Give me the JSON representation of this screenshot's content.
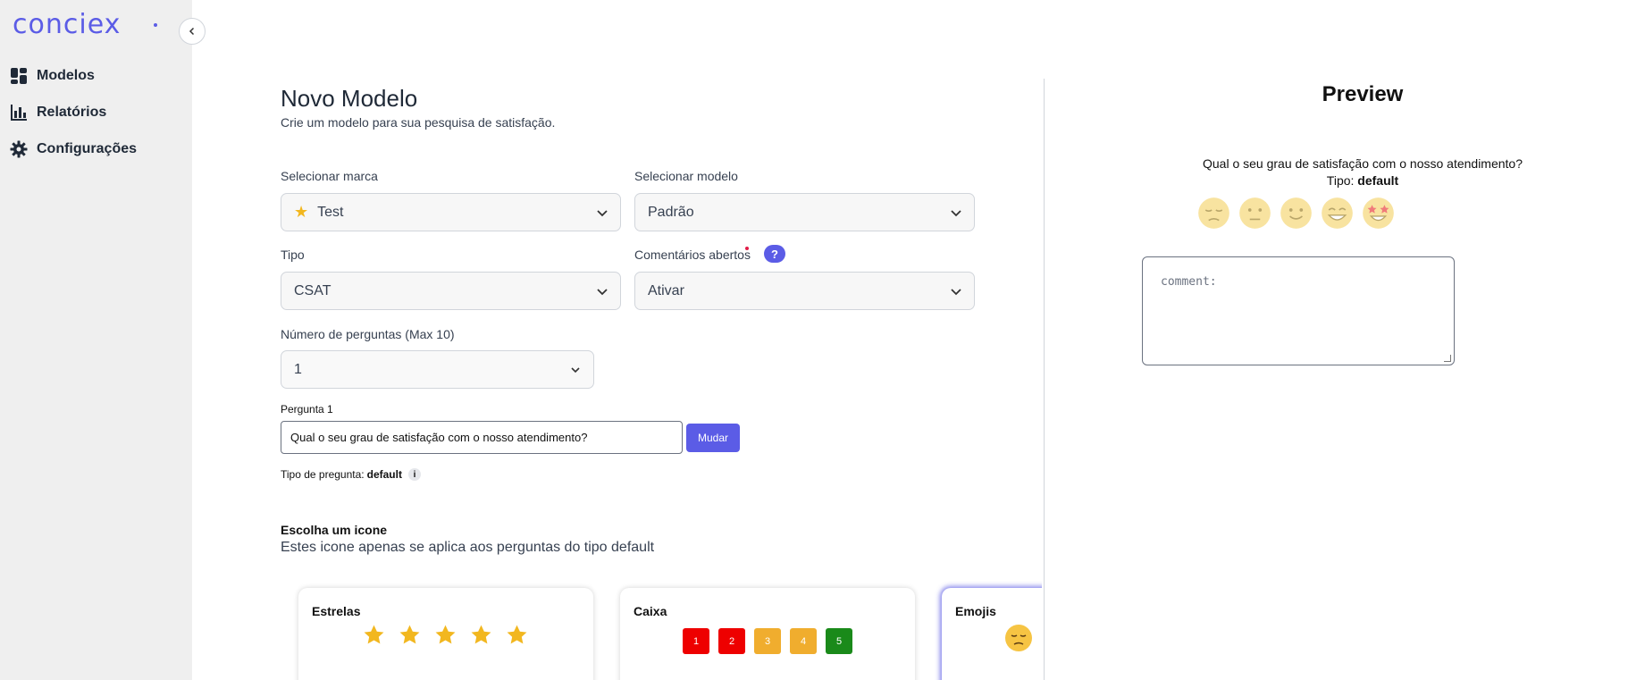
{
  "sidebar": {
    "logo": "conciex",
    "collapse_icon": "chevron-left-icon",
    "items": [
      {
        "label": "Modelos",
        "icon": "dashboard-icon"
      },
      {
        "label": "Relatórios",
        "icon": "bar-chart-icon"
      },
      {
        "label": "Configurações",
        "icon": "gear-icon"
      }
    ]
  },
  "header": {
    "title": "Novo Modelo",
    "subtitle": "Crie um modelo para sua pesquisa de satisfação."
  },
  "form": {
    "brand": {
      "label": "Selecionar marca",
      "value": "Test"
    },
    "model": {
      "label": "Selecionar modelo",
      "value": "Padrão"
    },
    "type": {
      "label": "Tipo",
      "value": "CSAT",
      "help": "?"
    },
    "comments": {
      "label": "Comentários abertos",
      "value": "Ativar"
    },
    "num_questions": {
      "label": "Número de perguntas (Max 10)",
      "value": "1"
    },
    "question": {
      "label": "Pergunta 1",
      "value": "Qual o seu grau de satisfação com o nosso atendimento?",
      "button": "Mudar",
      "type_label": "Tipo de pregunta:",
      "type_value": "default",
      "info": "i"
    }
  },
  "icon_picker": {
    "title": "Escolha um icone",
    "subtitle": "Estes icone apenas se aplica aos perguntas do tipo default",
    "cards": [
      {
        "title": "Estrelas"
      },
      {
        "title": "Caixa",
        "boxes": [
          "1",
          "2",
          "3",
          "4",
          "5"
        ],
        "box_colors": [
          "#ee0000",
          "#ee0000",
          "#f0ad2e",
          "#f0ad2e",
          "#1a8a1a"
        ]
      },
      {
        "title": "Emojis"
      }
    ]
  },
  "preview": {
    "title": "Preview",
    "question": "Qual o seu grau de satisfação com o nosso atendimento?",
    "type_label": "Tipo:",
    "type_value": "default",
    "comment_placeholder": "comment:"
  },
  "colors": {
    "accent": "#5b5ce6",
    "star": "#f2b71f"
  }
}
